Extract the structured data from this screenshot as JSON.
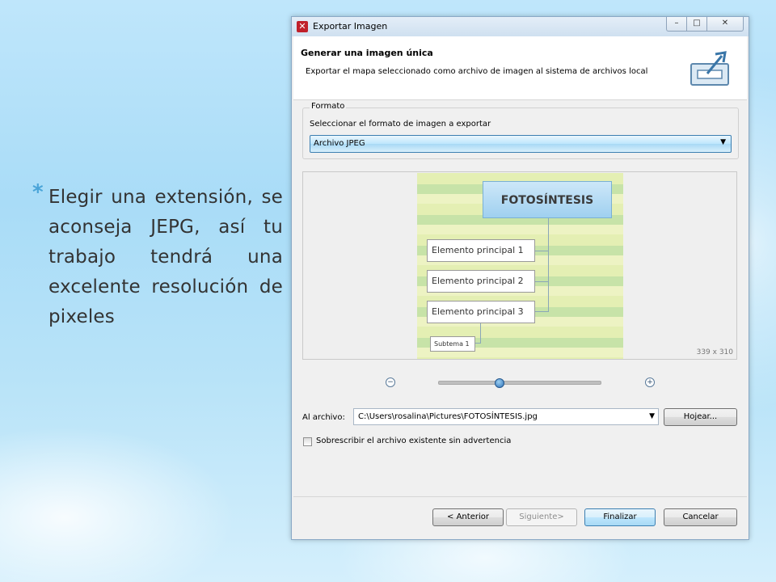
{
  "slide": {
    "bullet_marker": "*",
    "bullet_text": "Elegir una extensión, se aconseja JEPG, así tu trabajo tendrá una excelente resolución de pixeles"
  },
  "dialog": {
    "title": "Exportar Imagen",
    "window_buttons": {
      "minimize": "–",
      "maximize": "□",
      "close": "✕"
    },
    "header": {
      "title": "Generar una imagen única",
      "description": "Exportar el mapa seleccionado como archivo de imagen al sistema de archivos local"
    },
    "format_group": {
      "legend": "Formato",
      "label": "Seleccionar el formato de imagen a exportar",
      "selected": "Archivo JPEG"
    },
    "preview": {
      "main_topic": "FOTOSÍNTESIS",
      "topics": [
        "Elemento principal  1",
        "Elemento principal  2",
        "Elemento principal  3"
      ],
      "subtopic": "Subtema 1",
      "dimensions": "339 x 310"
    },
    "zoom": {
      "out_icon": "−",
      "in_icon": "+",
      "level": 0.37
    },
    "file": {
      "label": "Al archivo:",
      "path": "C:\\Users\\rosalina\\Pictures\\FOTOSÍNTESIS.jpg",
      "browse_label": "Hojear..."
    },
    "overwrite": {
      "label": "Sobrescribir el archivo existente sin advertencia",
      "checked": false
    },
    "buttons": {
      "back": "< Anterior",
      "next": "Siguiente>",
      "finish": "Finalizar",
      "cancel": "Cancelar"
    },
    "colors": {
      "accent": "#3c7fb1",
      "app_icon": "#c0202a",
      "bullet": "#4aa4d8"
    }
  }
}
